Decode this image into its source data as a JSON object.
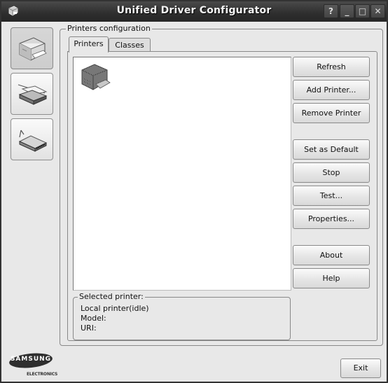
{
  "window": {
    "title": "Unified Driver Configurator",
    "controls": [
      {
        "name": "help",
        "glyph": "?"
      },
      {
        "name": "minimize",
        "glyph": "_"
      },
      {
        "name": "maximize",
        "glyph": "□"
      },
      {
        "name": "close",
        "glyph": "✕"
      }
    ]
  },
  "sidebar": {
    "items": [
      {
        "name": "printers-configuration",
        "icon": "printer-icon",
        "active": true
      },
      {
        "name": "scanners-configuration",
        "icon": "scanner-icon",
        "active": false
      },
      {
        "name": "ports-configuration",
        "icon": "port-icon",
        "active": false
      }
    ]
  },
  "main": {
    "group_title": "Printers configuration",
    "tabs": [
      {
        "label": "Printers",
        "active": true
      },
      {
        "label": "Classes",
        "active": false
      }
    ],
    "printer_list": [
      {
        "icon": "printer-icon",
        "label": ""
      }
    ],
    "buttons": {
      "refresh": "Refresh",
      "add_printer": "Add Printer...",
      "remove_printer": "Remove Printer",
      "set_default": "Set as Default",
      "stop": "Stop",
      "test": "Test...",
      "properties": "Properties...",
      "about": "About",
      "help": "Help"
    },
    "selected_printer": {
      "title": "Selected printer:",
      "status": "Local printer(idle)",
      "model_label": "Model:",
      "uri_label": "URI:"
    }
  },
  "footer": {
    "brand": "SAMSUNG",
    "brand_sub": "ELECTRONICS",
    "exit_label": "Exit"
  }
}
